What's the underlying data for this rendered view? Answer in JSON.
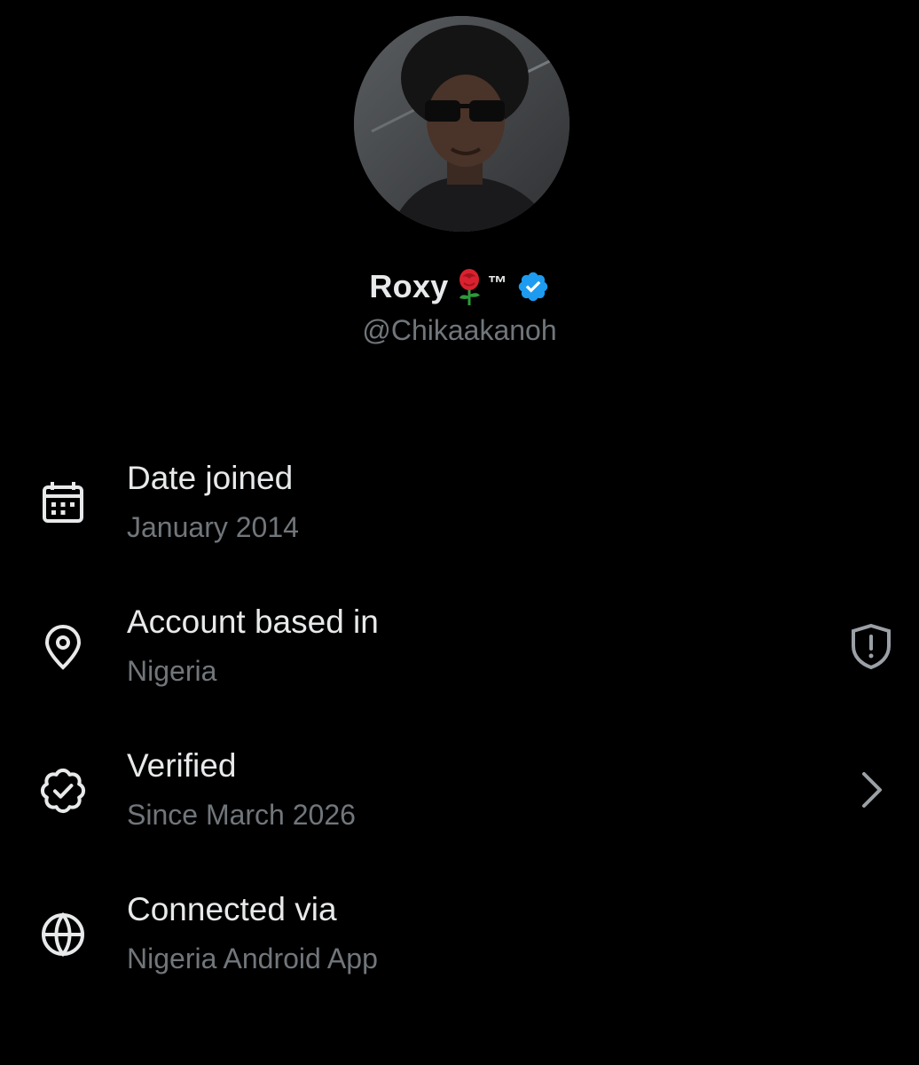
{
  "profile": {
    "display_name": "Roxy",
    "name_emoji": "rose-emoji",
    "name_suffix": "™",
    "verified_icon": "verified-badge-icon",
    "handle": "@Chikaakanoh"
  },
  "rows": [
    {
      "icon": "calendar-icon",
      "title": "Date joined",
      "subtitle": "January 2014"
    },
    {
      "icon": "location-pin-icon",
      "title": "Account based in",
      "subtitle": "Nigeria",
      "trailing_icon": "shield-alert-icon"
    },
    {
      "icon": "verified-outline-icon",
      "title": "Verified",
      "subtitle": "Since March 2026",
      "trailing_icon": "chevron-right-icon"
    },
    {
      "icon": "globe-icon",
      "title": "Connected via",
      "subtitle": "Nigeria Android App"
    }
  ],
  "colors": {
    "background": "#000000",
    "primary_text": "#e7e9ea",
    "secondary_text": "#71767b",
    "verified_blue": "#1d9bf0"
  }
}
